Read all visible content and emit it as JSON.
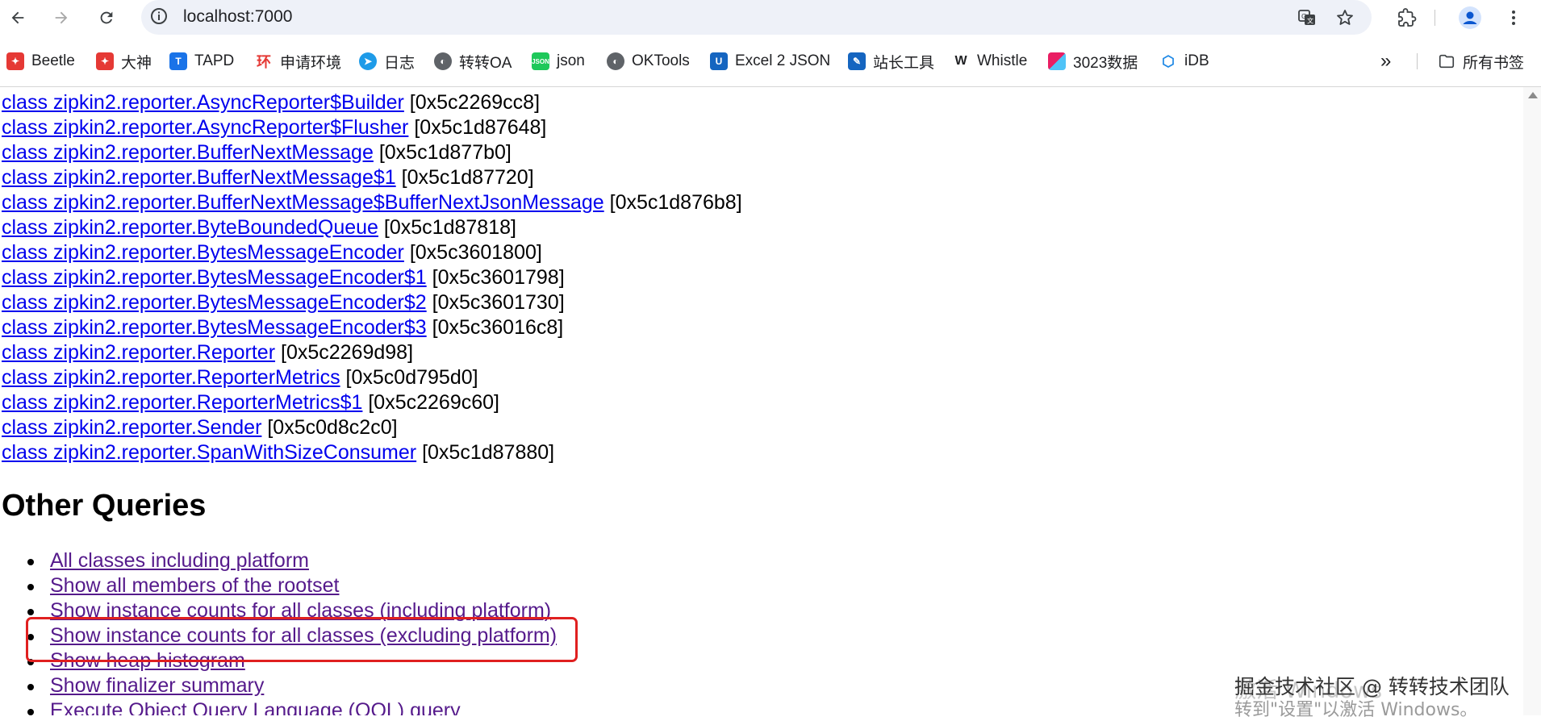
{
  "browser": {
    "url": "localhost:7000",
    "bookmarks": [
      {
        "label": "Beetle",
        "icon": "beetle-icon",
        "color": "#e53935"
      },
      {
        "label": "大神",
        "icon": "dashen-icon",
        "color": "#e53935"
      },
      {
        "label": "TAPD",
        "icon": "tapd-icon",
        "color": "#1a73e8"
      },
      {
        "label": "申请环境",
        "icon": "env-icon",
        "color": "#e53935"
      },
      {
        "label": "日志",
        "icon": "log-icon",
        "color": "#1e9be8"
      },
      {
        "label": "转转OA",
        "icon": "oa-icon",
        "color": "#5f6368"
      },
      {
        "label": "json",
        "icon": "json-icon",
        "color": "#1ec85a"
      },
      {
        "label": "OKTools",
        "icon": "oktools-icon",
        "color": "#5f6368"
      },
      {
        "label": "Excel 2 JSON",
        "icon": "excel2json-icon",
        "color": "#1565c0"
      },
      {
        "label": "站长工具",
        "icon": "webmaster-icon",
        "color": "#1565c0"
      },
      {
        "label": "Whistle",
        "icon": "whistle-icon",
        "color": "#202124"
      },
      {
        "label": "3023数据",
        "icon": "data-icon",
        "color": "#e91e63"
      },
      {
        "label": "iDB",
        "icon": "idb-icon",
        "color": "#1e88e5"
      }
    ],
    "more_bookmarks_label": "»",
    "all_bookmarks_label": "所有书签"
  },
  "classes": [
    {
      "name": "class zipkin2.reporter.AsyncReporter$Builder",
      "addr": "[0x5c2269cc8]"
    },
    {
      "name": "class zipkin2.reporter.AsyncReporter$Flusher",
      "addr": "[0x5c1d87648]"
    },
    {
      "name": "class zipkin2.reporter.BufferNextMessage",
      "addr": "[0x5c1d877b0]"
    },
    {
      "name": "class zipkin2.reporter.BufferNextMessage$1",
      "addr": "[0x5c1d87720]"
    },
    {
      "name": "class zipkin2.reporter.BufferNextMessage$BufferNextJsonMessage",
      "addr": "[0x5c1d876b8]"
    },
    {
      "name": "class zipkin2.reporter.ByteBoundedQueue",
      "addr": "[0x5c1d87818]"
    },
    {
      "name": "class zipkin2.reporter.BytesMessageEncoder",
      "addr": "[0x5c3601800]"
    },
    {
      "name": "class zipkin2.reporter.BytesMessageEncoder$1",
      "addr": "[0x5c3601798]"
    },
    {
      "name": "class zipkin2.reporter.BytesMessageEncoder$2",
      "addr": "[0x5c3601730]"
    },
    {
      "name": "class zipkin2.reporter.BytesMessageEncoder$3",
      "addr": "[0x5c36016c8]"
    },
    {
      "name": "class zipkin2.reporter.Reporter",
      "addr": "[0x5c2269d98]"
    },
    {
      "name": "class zipkin2.reporter.ReporterMetrics",
      "addr": "[0x5c0d795d0]"
    },
    {
      "name": "class zipkin2.reporter.ReporterMetrics$1",
      "addr": "[0x5c2269c60]"
    },
    {
      "name": "class zipkin2.reporter.Sender",
      "addr": "[0x5c0d8c2c0]"
    },
    {
      "name": "class zipkin2.reporter.SpanWithSizeConsumer",
      "addr": "[0x5c1d87880]"
    }
  ],
  "other_queries": {
    "heading": "Other Queries",
    "items": [
      "All classes including platform",
      "Show all members of the rootset",
      "Show instance counts for all classes (including platform)",
      "Show instance counts for all classes (excluding platform)",
      "Show heap histogram",
      "Show finalizer summary",
      "Execute Object Query Language (OQL) query"
    ]
  },
  "watermark": {
    "text": "掘金技术社区 @ 转转技术团队",
    "ghost": "激活 Windows",
    "line2": "转到\"设置\"以激活 Windows。"
  },
  "colors": {
    "link": "#0000ee",
    "visited_link": "#551a8b",
    "highlight": "#e02020"
  }
}
